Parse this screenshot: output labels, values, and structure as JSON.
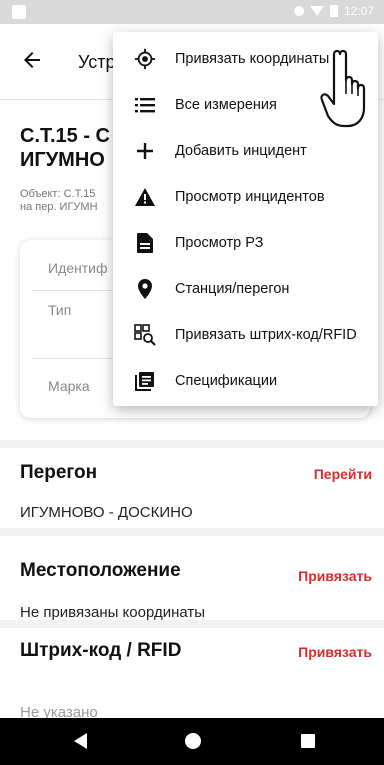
{
  "status_bar": {
    "time": "12:07"
  },
  "app_bar": {
    "title": "Устр"
  },
  "object": {
    "title_line1": "С.Т.15 - С",
    "title_line2": "ИГУМНО",
    "subtitle_line1": "Объект: С.Т.15",
    "subtitle_line2": "на пер. ИГУМН"
  },
  "card": {
    "fields": [
      {
        "label": "Идентиф"
      },
      {
        "label": "Тип"
      },
      {
        "label": "Марка"
      }
    ]
  },
  "sections": {
    "peregon": {
      "title": "Перегон",
      "action": "Перейти",
      "value": "ИГУМНОВО - ДОСКИНО"
    },
    "location": {
      "title": "Местоположение",
      "action": "Привязать",
      "value": "Не привязаны координаты"
    },
    "barcode": {
      "title": "Штрих-код / RFID",
      "action": "Привязать",
      "value": "Не указано"
    }
  },
  "menu": {
    "items": [
      {
        "label": "Привязать координаты",
        "icon": "crosshair-icon"
      },
      {
        "label": "Все измерения",
        "icon": "list-icon"
      },
      {
        "label": "Добавить инцидент",
        "icon": "plus-icon"
      },
      {
        "label": "Просмотр инцидентов",
        "icon": "warning-icon"
      },
      {
        "label": "Просмотр РЗ",
        "icon": "document-icon"
      },
      {
        "label": "Станция/перегон",
        "icon": "location-pin-icon"
      },
      {
        "label": "Привязать штрих-код/RFID",
        "icon": "barcode-search-icon"
      },
      {
        "label": "Спецификации",
        "icon": "specifications-icon"
      }
    ]
  },
  "colors": {
    "accent": "#d32f2f",
    "status_bar": "#d9d9d9",
    "nav_bar": "#000000"
  }
}
